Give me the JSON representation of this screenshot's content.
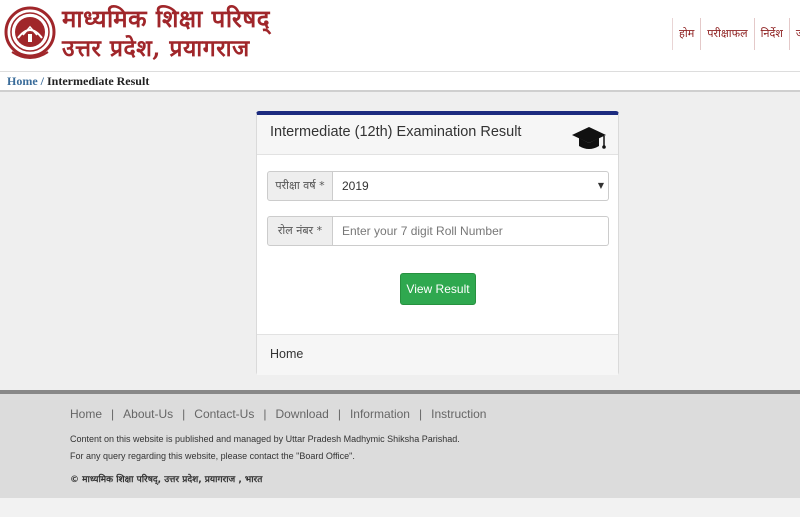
{
  "header": {
    "title_line1": "माध्यमिक शिक्षा परिषद्",
    "title_line2": "उत्तर प्रदेश, प्रयागराज",
    "nav": [
      "होम",
      "परीक्षाफल",
      "निर्देश",
      "जा"
    ]
  },
  "breadcrumb": {
    "home": "Home",
    "separator": " / ",
    "current": "Intermediate Result"
  },
  "card": {
    "title": "Intermediate (12th) Examination Result",
    "year_label": "परीक्षा वर्ष *",
    "year_value": "2019",
    "roll_label": "रोल नंबर *",
    "roll_placeholder": "Enter your 7 digit Roll Number",
    "button": "View Result",
    "footer_link": "Home"
  },
  "footer": {
    "links": [
      "Home",
      "About-Us",
      "Contact-Us",
      "Download",
      "Information",
      "Instruction"
    ],
    "separator": "|",
    "line1": "Content on this website is published and managed by Uttar Pradesh Madhymic Shiksha Parishad.",
    "line2": "For any query regarding this website, please contact the \"Board Office\".",
    "copyright": "© माध्यमिक शिक्षा परिषद्, उत्तर प्रदेश, प्रयागराज , भारत"
  },
  "colors": {
    "brand_red": "#a0262a",
    "card_accent": "#1c2b7f",
    "button_green": "#2fa84f"
  },
  "icons": [
    "emblem-logo",
    "graduation-cap-icon",
    "chevron-down-icon"
  ]
}
